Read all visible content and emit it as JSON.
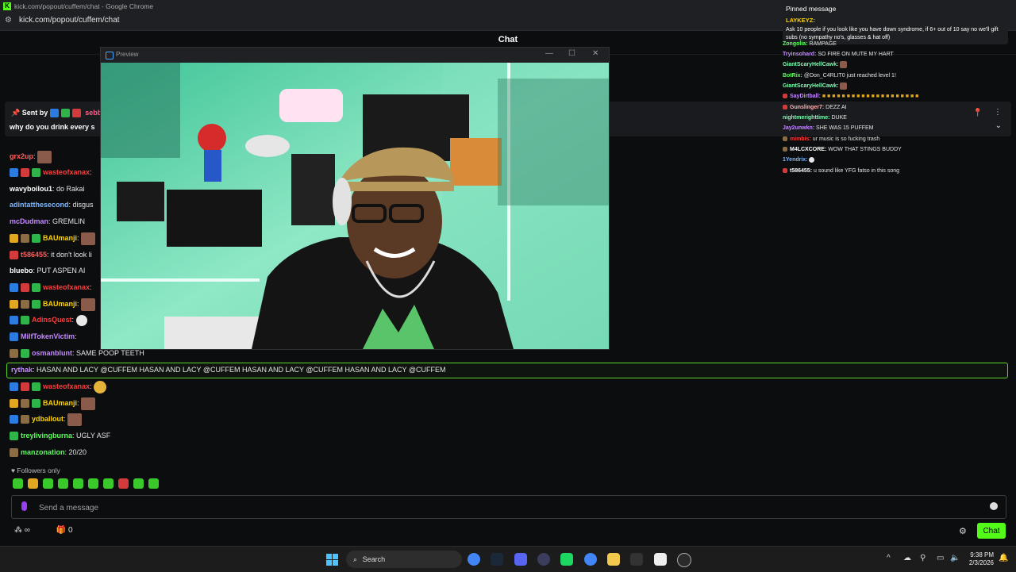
{
  "browser": {
    "title": "kick.com/popout/cuffem/chat - Google Chrome",
    "url": "kick.com/popout/cuffem/chat"
  },
  "chat": {
    "title": "Chat",
    "sent_by": {
      "prefix": "Sent by",
      "user": "sebb",
      "message": "why do you drink every s"
    },
    "messages": [
      {
        "user": "grx2up",
        "color": "#ff5f5f",
        "badges": [],
        "text": "",
        "emote": true
      },
      {
        "user": "wasteofxanax",
        "color": "#ff3d3d",
        "badges": [
          "blue",
          "red",
          "green"
        ],
        "text": "",
        "emote": false
      },
      {
        "user": "wavyboilou1",
        "color": "#ffffff",
        "badges": [],
        "text": "do Rakai"
      },
      {
        "user": "adintatthesecond",
        "color": "#7db7ff",
        "badges": [],
        "text": "disgus"
      },
      {
        "user": "mcDudman",
        "color": "#c48bff",
        "badges": [],
        "text": "GREMLIN"
      },
      {
        "user": "BAUmanji",
        "color": "#ffd400",
        "badges": [
          "gold",
          "tan",
          "green"
        ],
        "text": "",
        "emote": true
      },
      {
        "user": "t586455",
        "color": "#ff5f5f",
        "badges": [
          "red"
        ],
        "text": "it don't look li"
      },
      {
        "user": "bluebo",
        "color": "#ffffff",
        "badges": [],
        "text": "PUT ASPEN AI"
      },
      {
        "user": "wasteofxanax",
        "color": "#ff3d3d",
        "badges": [
          "blue",
          "red",
          "green"
        ],
        "text": ""
      },
      {
        "user": "BAUmanji",
        "color": "#ffd400",
        "badges": [
          "gold",
          "tan",
          "green"
        ],
        "text": "",
        "emote": true
      },
      {
        "user": "AdinsQuest",
        "color": "#ff3d3d",
        "badges": [
          "blue",
          "green"
        ],
        "text": "",
        "emote_white": true
      },
      {
        "user": "MilfTokenVictim",
        "color": "#c48bff",
        "badges": [
          "blue"
        ],
        "text": ""
      },
      {
        "user": "osmanblunt",
        "color": "#c48bff",
        "badges": [
          "tan",
          "green"
        ],
        "text": "SAME POOP TEETH"
      }
    ],
    "highlight": {
      "user": "rythak",
      "text": "HASAN AND LACY @CUFFEM HASAN AND LACY @CUFFEM HASAN AND LACY @CUFFEM HASAN AND LACY @CUFFEM"
    },
    "messages_after": [
      {
        "user": "wasteofxanax",
        "color": "#ff3d3d",
        "badges": [
          "blue",
          "red",
          "green"
        ],
        "text": "",
        "emote_smile": true
      },
      {
        "user": "BAUmanji",
        "color": "#ffd400",
        "badges": [
          "gold",
          "tan",
          "green"
        ],
        "text": "",
        "emote": true
      },
      {
        "user": "ydballout",
        "color": "#ffd400",
        "badges": [
          "blue",
          "tan"
        ],
        "text": "",
        "emote": true
      },
      {
        "user": "treylivingburna",
        "color": "#5cff5c",
        "badges": [
          "green"
        ],
        "text": "UGLY ASF"
      },
      {
        "user": "manzonation",
        "color": "#5cff5c",
        "badges": [
          "tan"
        ],
        "text": "20/20"
      }
    ],
    "followers_only": "Followers only",
    "input_placeholder": "Send a message",
    "connections_count": "0",
    "send_label": "Chat"
  },
  "overlay_chat": {
    "pinned_title": "Pinned message",
    "pinned_user": "LAYKEYZ:",
    "pinned_text": "Ask 10 people if you look like you have down syndrome, if 6+ out of 10 say no we'll gift subs (no sympathy no's, glasses & hat off)",
    "messages": [
      {
        "user": "Zongolia:",
        "color": "#5cff5c",
        "text": "RAMPAGE"
      },
      {
        "user": "Tryinsohard:",
        "color": "#c48bff",
        "text": "SO FIRE ON MUTE MY HART"
      },
      {
        "user": "GiantScaryHellCawk:",
        "color": "#7dffb3",
        "text": ""
      },
      {
        "user": "BotRix:",
        "color": "#5cff5c",
        "text": "@Don_C4RLIT0 just reached level 1!"
      },
      {
        "user": "GiantScaryHellCawk:",
        "color": "#7dffb3",
        "text": ""
      },
      {
        "user": "SayDirtball:",
        "color": "#c48bff",
        "text": ""
      },
      {
        "user": "Gunslinger7:",
        "color": "#ffb3b3",
        "text": "DEZZ AI"
      },
      {
        "user": "nightmerighttime:",
        "color": "#7dffb3",
        "text": "DUKE"
      },
      {
        "user": "Jay2unwkn:",
        "color": "#c48bff",
        "text": "SHE WAS 15 PUFFEM"
      },
      {
        "user": "mimbis:",
        "color": "#ff3d3d",
        "text": "ur music is so fucking trash"
      },
      {
        "user": "M4LCXCORE:",
        "color": "#ffffff",
        "text": "WOW THAT STINGS BUDDY"
      },
      {
        "user": "1Yendrix:",
        "color": "#7db7ff",
        "text": ""
      },
      {
        "user": "t586455:",
        "color": "#ffffff",
        "text": "u sound like YFG fatso in this song"
      }
    ]
  },
  "preview": {
    "title": "Preview"
  },
  "taskbar": {
    "search_label": "Search",
    "time": "9:38 PM",
    "date": "2/3/2026"
  },
  "colors": {
    "accent": "#53fc18",
    "bg": "#0c0d0e"
  }
}
